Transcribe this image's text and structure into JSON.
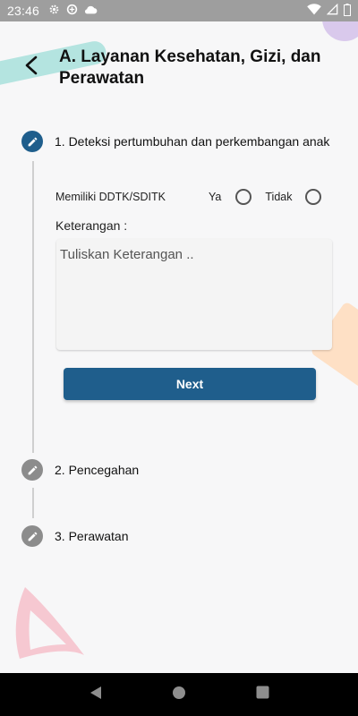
{
  "status_bar": {
    "time": "23:46",
    "icons": [
      "gear-icon",
      "data-saver-icon",
      "cloud-icon",
      "wifi-icon",
      "signal-icon",
      "battery-icon"
    ]
  },
  "header": {
    "title": "A. Layanan Kesehatan, Gizi, dan Perawatan"
  },
  "steps": [
    {
      "label": "1. Deteksi pertumbuhan dan perkembangan anak",
      "state": "active"
    },
    {
      "label": "2. Pencegahan",
      "state": "inactive"
    },
    {
      "label": "3. Perawatan",
      "state": "inactive"
    }
  ],
  "form": {
    "question": "Memiliki DDTK/SDITK",
    "option_yes": "Ya",
    "option_no": "Tidak",
    "notes_label": "Keterangan :",
    "notes_placeholder": "Tuliskan Keterangan ..",
    "next_button": "Next"
  },
  "colors": {
    "primary": "#1f5e8c",
    "inactive_step": "#8c8c8c",
    "background": "#f7f7f8"
  },
  "nav_bar": {
    "icons": [
      "back-icon",
      "home-icon",
      "recents-icon"
    ]
  }
}
